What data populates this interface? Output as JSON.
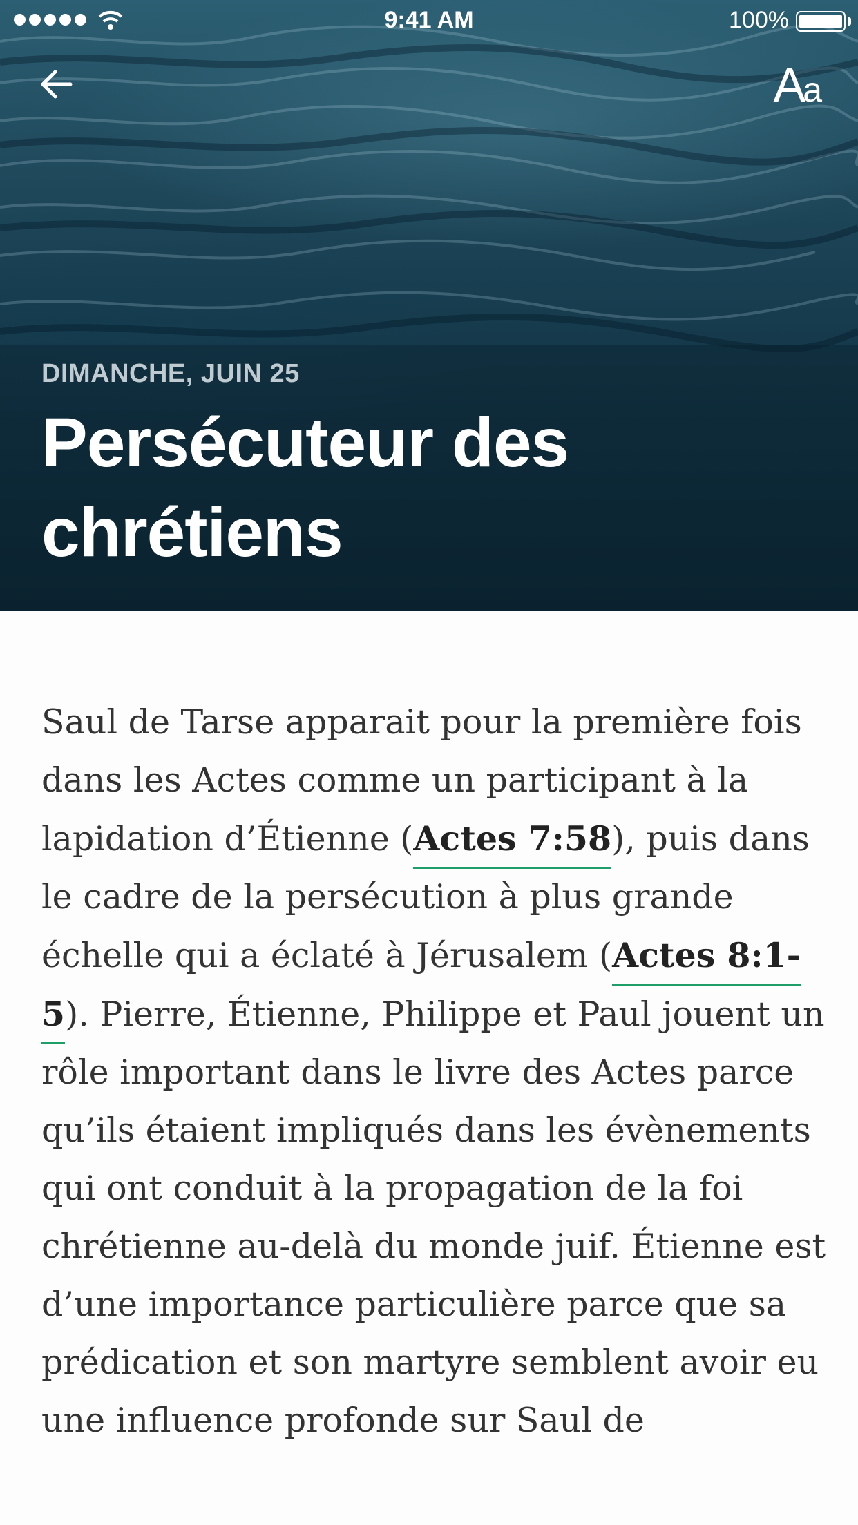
{
  "status_bar": {
    "time": "9:41 AM",
    "battery": "100%",
    "signal_icon": "signal-dots-icon",
    "wifi_icon": "wifi-icon",
    "battery_icon": "battery-icon"
  },
  "header": {
    "back_icon": "arrow-left-icon",
    "font_size_label_big": "A",
    "font_size_label_small": "a",
    "hero_image": "ocean-water-image"
  },
  "article": {
    "date": "DIMANCHE, JUIN 25",
    "title": "Persécuteur des chrétiens",
    "body": {
      "part1": "Saul de Tarse apparait pour la première fois dans les Actes comme un participant à la lapidation d’Étienne (",
      "ref1": "Actes 7:58",
      "part2": "), puis dans le cadre de la persécution à plus grande échelle qui a éclaté à Jérusalem (",
      "ref2": "Actes 8:1-5",
      "part3": "). Pierre, Étienne, Philippe et Paul jouent un rôle important dans le livre des Actes parce qu’ils étaient impliqués dans les évènements qui ont conduit à la propagation de la foi chrétienne au-delà du monde juif. Étienne est d’une importance particulière parce que sa prédication et son martyre semblent avoir eu une influence profonde sur Saul de"
    }
  },
  "colors": {
    "link_underline": "#1e9f6a",
    "body_text": "#333333",
    "hero_dark": "#0c2633"
  }
}
